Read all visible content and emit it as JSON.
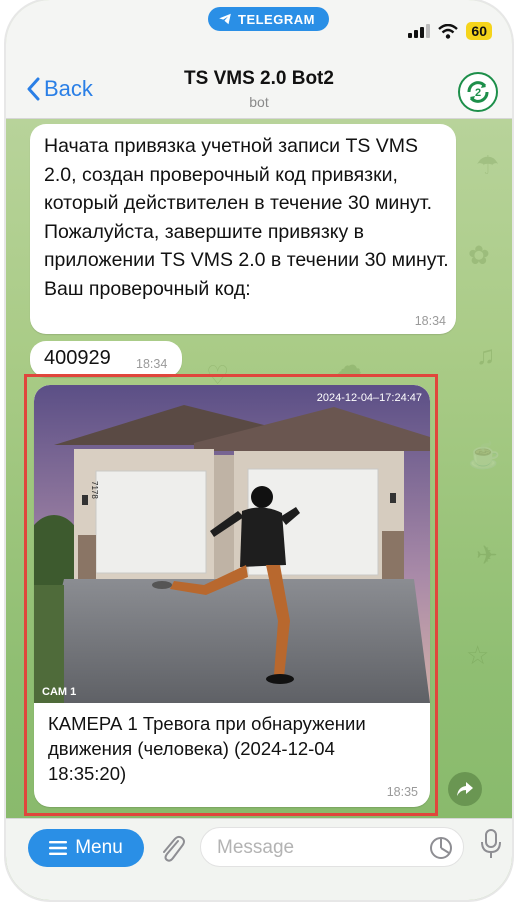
{
  "status_bar": {
    "pill_label": "TELEGRAM",
    "battery": "60"
  },
  "header": {
    "back_label": "Back",
    "title": "TS VMS 2.0 Bot2",
    "subtitle": "bot"
  },
  "messages": [
    {
      "text": "Начата привязка учетной записи TS VMS 2.0, создан проверочный код привязки, который действителен в течение 30 минут. Пожалуйста, завершите привязку в приложении TS VMS 2.0 в течении 30 минут. Ваш проверочный код:",
      "time": "18:34"
    },
    {
      "text": "400929",
      "time": "18:34"
    },
    {
      "photo_timestamp": "2024-12-04–17:24:47",
      "photo_camera_label": "CAM 1",
      "photo_house_number": "7178",
      "caption": "КАМЕРА 1 Тревога при обнаружении движения (человека) (2024-12-04 18:35:20)",
      "time": "18:35"
    }
  ],
  "composer": {
    "menu_label": "Menu",
    "placeholder": "Message"
  },
  "colors": {
    "accent": "#2a8fe6",
    "highlight_frame": "#e0463c",
    "chat_background": "#a9cb86"
  },
  "icons": [
    "telegram-plane-icon",
    "signal-icon",
    "wifi-icon",
    "back-chevron-icon",
    "bot-avatar-icon",
    "share-icon",
    "menu-icon",
    "attach-icon",
    "sticker-icon",
    "mic-icon"
  ]
}
